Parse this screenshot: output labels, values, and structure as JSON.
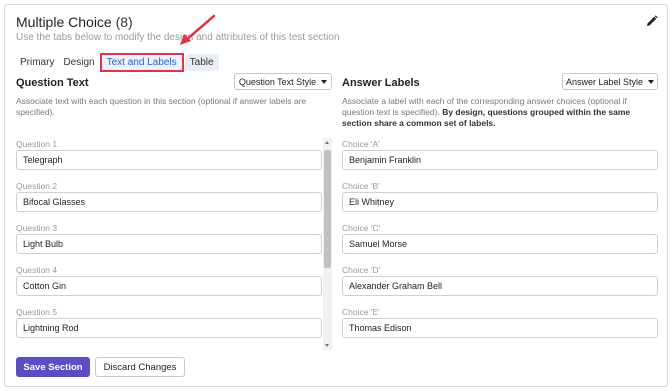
{
  "header": {
    "title": "Multiple Choice",
    "count": "(8)",
    "subtitle": "Use the tabs below to modify the design and attributes of this test section"
  },
  "tabs": [
    "Primary",
    "Design",
    "Text and Labels",
    "Table"
  ],
  "active_tab": "Text and Labels",
  "question_text": {
    "heading": "Question Text",
    "style_button": "Question Text Style",
    "description": "Associate text with each question in this section (optional if answer labels are specified).",
    "items": [
      {
        "label": "Question 1",
        "value": "Telegraph"
      },
      {
        "label": "Question 2",
        "value": "Bifocal Glasses"
      },
      {
        "label": "Question 3",
        "value": "Light Bulb"
      },
      {
        "label": "Question 4",
        "value": "Cotton Gin"
      },
      {
        "label": "Question 5",
        "value": "Lightning Rod"
      }
    ]
  },
  "answer_labels": {
    "heading": "Answer Labels",
    "style_button": "Answer Label Style",
    "description": "Associate a label with each of the corresponding answer choices (optional if question text is specified).",
    "description_bold": "By design, questions grouped within the same section share a common set of labels.",
    "items": [
      {
        "label": "Choice 'A'",
        "value": "Benjamin Franklin"
      },
      {
        "label": "Choice 'B'",
        "value": "Eli Whitney"
      },
      {
        "label": "Choice 'C'",
        "value": "Samuel Morse"
      },
      {
        "label": "Choice 'D'",
        "value": "Alexander Graham Bell"
      },
      {
        "label": "Choice 'E'",
        "value": "Thomas Edison"
      }
    ]
  },
  "footer": {
    "save_label": "Save Section",
    "discard_label": "Discard Changes"
  },
  "colors": {
    "primary_button": "#5a4ec2",
    "active_tab_text": "#2f63c9",
    "highlight": "#e0334a"
  },
  "icons": {
    "edit": "pencil-icon",
    "dropdown": "caret-down-icon"
  }
}
